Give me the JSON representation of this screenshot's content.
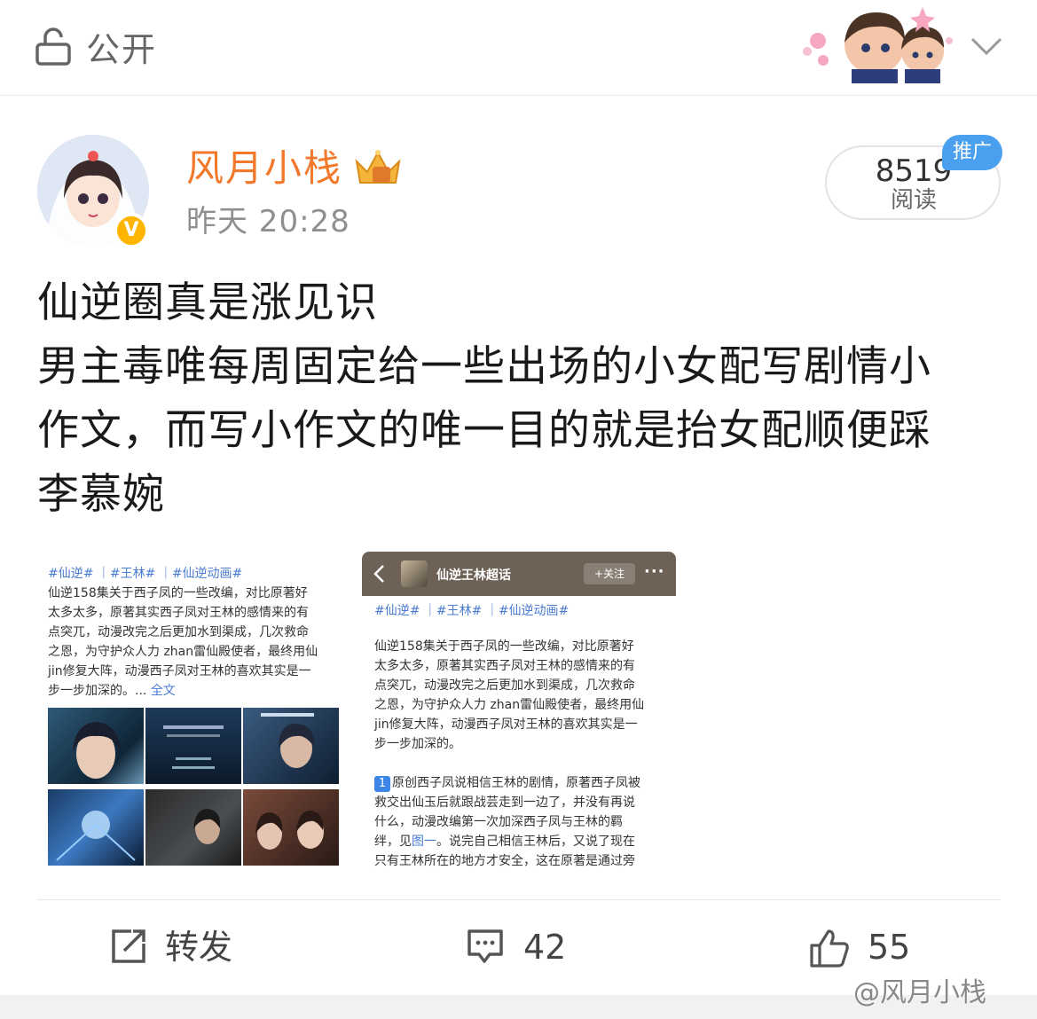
{
  "topbar": {
    "visibility_label": "公开",
    "icons": [
      "lock-icon",
      "chevron-down-icon"
    ]
  },
  "post": {
    "username": "风月小栈",
    "time": "昨天 20:28",
    "read_count": "8519",
    "read_label": "阅读",
    "promo_label": "推广",
    "verified_badge": "V",
    "text_lines": [
      "仙逆圈真是涨见识",
      "男主毒唯每周固定给一些出场的小女配写剧情小",
      "作文，而写小作文的唯一目的就是抬女配顺便踩",
      "李慕婉"
    ],
    "colors": {
      "username": "#f2782b",
      "promo": "#4aa0ee",
      "badge": "#ffb400",
      "link": "#4a7bd0"
    }
  },
  "image1": {
    "tags": "#仙逆# ｜#王林# ｜#仙逆动画#",
    "lines": [
      "仙逆158集关于西子凤的一些改编，对比原著好",
      "太多太多，原著其实西子凤对王林的感情来的有",
      "点突兀，动漫改完之后更加水到渠成，几次救命",
      "之恩，为守护众人力 zhan雷仙殿使者，最终用仙",
      "jin修复大阵，动漫西子凤对王林的喜欢其实是一"
    ],
    "last_line": "步一步加深的。... ",
    "more": "全文"
  },
  "image2": {
    "title": "仙逆王林超话",
    "follow": "+关注",
    "dots": "···",
    "tags": "#仙逆# ｜#王林# ｜#仙逆动画#",
    "lines": [
      "仙逆158集关于西子凤的一些改编，对比原著好",
      "太多太多，原著其实西子凤对王林的感情来的有",
      "点突兀，动漫改完之后更加水到渠成，几次救命",
      "之恩，为守护众人力 zhan雷仙殿使者，最终用仙",
      "jin修复大阵，动漫西子凤对王林的喜欢其实是一",
      "步一步加深的。"
    ],
    "num_badge": "1",
    "lines2": [
      "原创西子凤说相信王林的剧情，原著西子凤被",
      "救交出仙玉后就跟战芸走到一边了，并没有再说",
      "什么，动漫改编第一次加深西子凤与王林的羁"
    ],
    "line_pre": "绊，见",
    "line_link": "图一",
    "line_post": "。说完自己相信王林后，又说了现在",
    "last_line": "只有王林所在的地方才安全，这在原著是通过旁"
  },
  "actions": {
    "repost": "转发",
    "comments": "42",
    "likes": "55"
  },
  "watermark": "@风月小栈"
}
